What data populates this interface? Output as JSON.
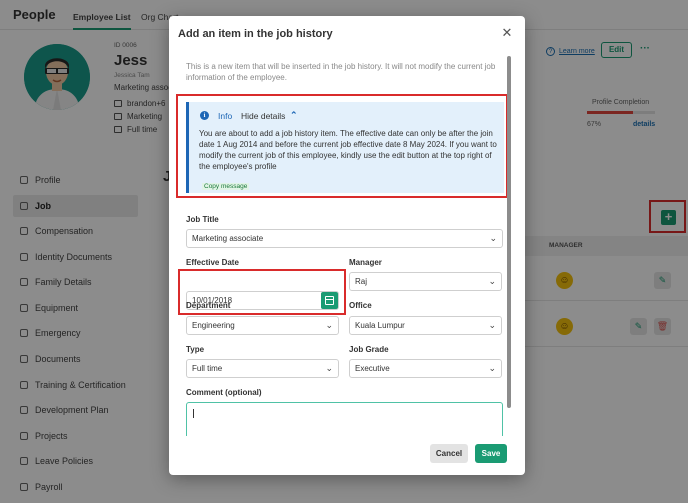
{
  "app": {
    "brand": "People",
    "tabs": [
      "Employee List",
      "Org Chart"
    ]
  },
  "employee": {
    "id": "ID 0006",
    "name": "Jess",
    "full_name": "Jessica Tam",
    "position": "Marketing associate",
    "email": "brandon+6",
    "department": "Marketing",
    "type": "Full time"
  },
  "header_actions": {
    "learn_more": "Learn more",
    "edit": "Edit",
    "more": "···"
  },
  "profile_completion": {
    "label": "Profile Completion",
    "value": "67%",
    "percent": 67,
    "details": "details",
    "bar_color": "#e0453d"
  },
  "sidebar": {
    "items": [
      {
        "label": "Profile",
        "icon": "person-icon"
      },
      {
        "label": "Job",
        "icon": "briefcase-icon",
        "active": true
      },
      {
        "label": "Compensation",
        "icon": "money-icon"
      },
      {
        "label": "Identity Documents",
        "icon": "id-card-icon"
      },
      {
        "label": "Family Details",
        "icon": "family-icon"
      },
      {
        "label": "Equipment",
        "icon": "laptop-icon"
      },
      {
        "label": "Emergency",
        "icon": "phone-icon"
      },
      {
        "label": "Documents",
        "icon": "folder-icon"
      },
      {
        "label": "Training & Certification",
        "icon": "certificate-icon"
      },
      {
        "label": "Development Plan",
        "icon": "chart-icon"
      },
      {
        "label": "Projects",
        "icon": "project-icon"
      },
      {
        "label": "Leave Policies",
        "icon": "calendar-icon"
      },
      {
        "label": "Payroll",
        "icon": "payroll-icon"
      }
    ]
  },
  "main": {
    "title": "J",
    "table": {
      "manager_header": "MANAGER"
    }
  },
  "modal": {
    "title": "Add an item in the job history",
    "intro": "This is a new item that will be inserted in the job history. It will not modify the current job information of the employee.",
    "info": {
      "label": "Info",
      "toggle": "Hide details",
      "text": "You are about to add a job history item. The effective date can only be after the join date 1 Aug 2014 and before the current job effective date 8 May 2024. If you want to modify the current job of this employee, kindly use the edit button at the top right of the employee's profile",
      "copy": "Copy message"
    },
    "fields": {
      "job_title": {
        "label": "Job Title",
        "value": "Marketing associate"
      },
      "effective_date": {
        "label": "Effective Date",
        "value": "10/01/2018"
      },
      "manager": {
        "label": "Manager",
        "value": "Raj"
      },
      "department": {
        "label": "Department",
        "value": "Engineering"
      },
      "office": {
        "label": "Office",
        "value": "Kuala Lumpur"
      },
      "type": {
        "label": "Type",
        "value": "Full time"
      },
      "job_grade": {
        "label": "Job Grade",
        "value": "Executive"
      },
      "comment": {
        "label": "Comment (optional)",
        "value": ""
      }
    },
    "buttons": {
      "cancel": "Cancel",
      "save": "Save"
    }
  },
  "colors": {
    "accent": "#1a9b73",
    "info_blue": "#1d66b5",
    "highlight_red": "#d92b2b"
  }
}
